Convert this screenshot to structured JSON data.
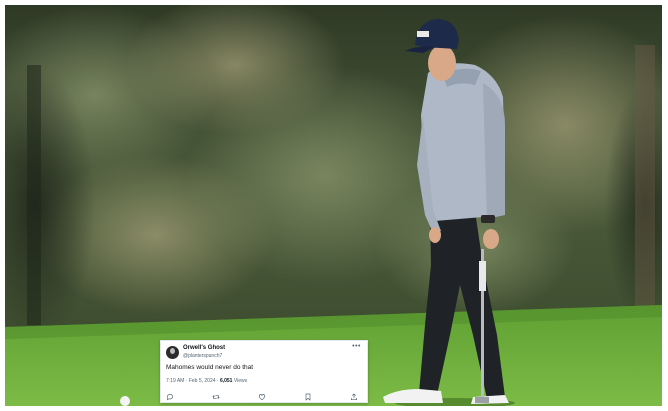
{
  "tweet": {
    "display_name": "Orwell's Ghost",
    "handle": "@planterspunch7",
    "more_icon": "more-horizontal-icon",
    "text": "Mahomes would never do that",
    "time": "7:19 AM",
    "date": "Feb 5, 2024",
    "separator": " · ",
    "views_count": "6,051",
    "views_label": " Views",
    "actions": [
      "reply-icon",
      "retweet-icon",
      "like-icon",
      "bookmark-icon",
      "share-icon"
    ]
  },
  "colors": {
    "grass": "#6fae3c",
    "trees": "#3b4a2c",
    "hoodie": "#aeb8c6",
    "pants": "#1f2226",
    "cap": "#1e2a4a"
  }
}
